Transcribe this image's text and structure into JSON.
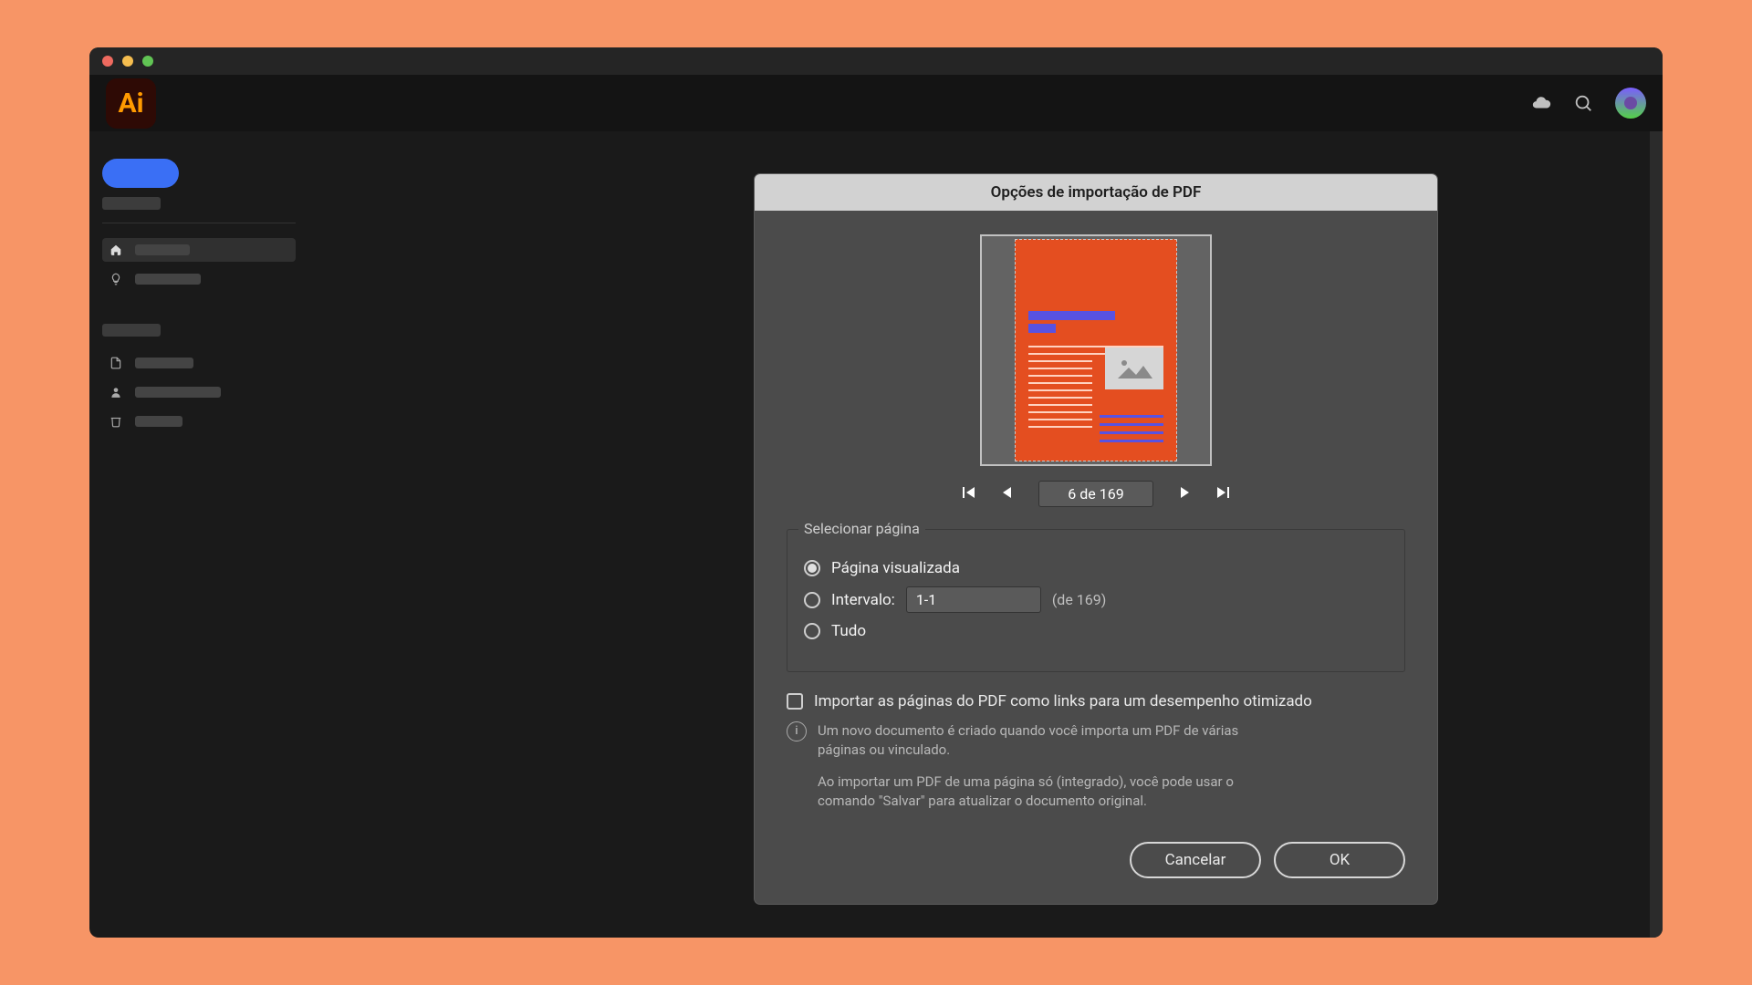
{
  "titlebar": {
    "dot_close": "#ee6a5f",
    "dot_min": "#f5bd4f",
    "dot_max": "#61c454"
  },
  "app": {
    "logo_text": "Ai"
  },
  "dialog": {
    "title": "Opções de importação de PDF",
    "pager": {
      "current": "6",
      "sep": "de",
      "total": "169"
    },
    "fieldset_legend": "Selecionar página",
    "radio_previewed": "Página visualizada",
    "radio_range": "Intervalo:",
    "range_value": "1-1",
    "range_of": "(de 169)",
    "radio_all": "Tudo",
    "checkbox_import_links": "Importar as páginas do PDF como links para um desempenho otimizado",
    "info_p1": "Um novo documento é criado quando você importa um PDF de várias páginas ou vinculado.",
    "info_p2": "Ao importar um PDF de uma página só (integrado), você pode usar o comando \"Salvar\" para atualizar o documento original.",
    "cancel": "Cancelar",
    "ok": "OK"
  }
}
